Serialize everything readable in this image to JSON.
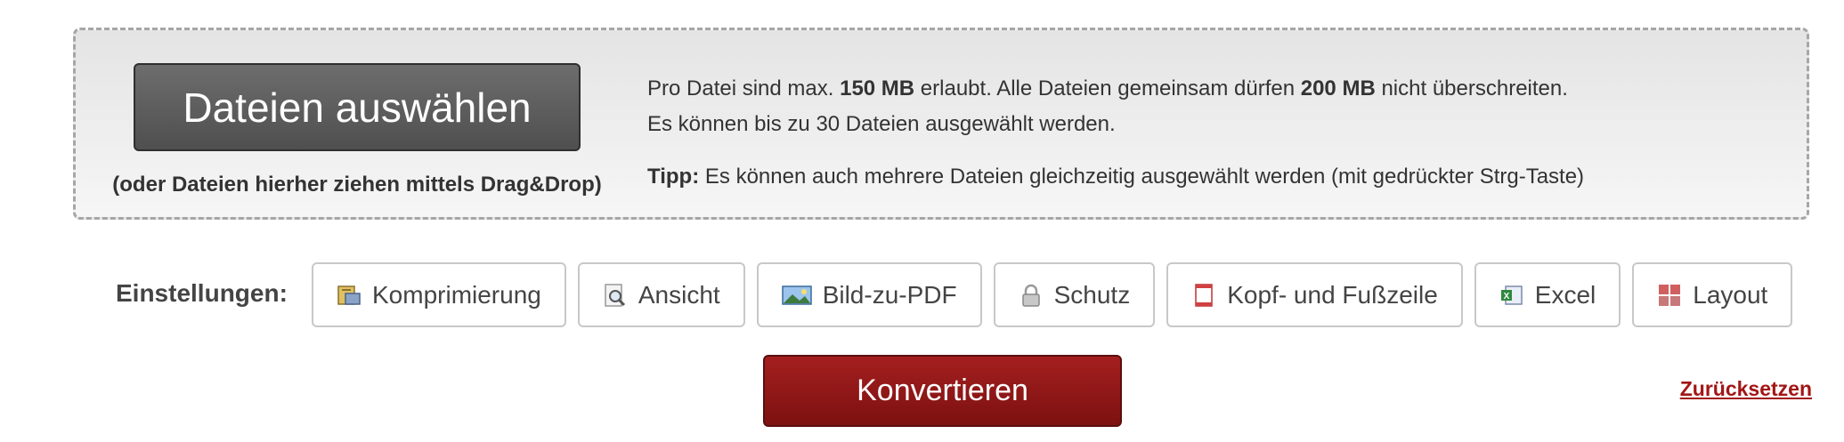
{
  "upload": {
    "choose_label": "Dateien auswählen",
    "drag_hint": "(oder Dateien hierher ziehen mittels Drag&Drop)",
    "info_line1_part1": "Pro Datei sind max. ",
    "info_line1_bold1": "150 MB",
    "info_line1_part2": " erlaubt. Alle Dateien gemeinsam dürfen ",
    "info_line1_bold2": "200 MB",
    "info_line1_part3": " nicht überschreiten.",
    "info_line2": "Es können bis zu 30 Dateien ausgewählt werden.",
    "tip_label": "Tipp:",
    "tip_text": " Es können auch mehrere Dateien gleichzeitig ausgewählt werden (mit gedrückter Strg-Taste)"
  },
  "settings": {
    "label": "Einstellungen:",
    "buttons": [
      {
        "label": "Komprimierung",
        "icon": "compress-icon"
      },
      {
        "label": "Ansicht",
        "icon": "magnifier-icon"
      },
      {
        "label": "Bild-zu-PDF",
        "icon": "image-icon"
      },
      {
        "label": "Schutz",
        "icon": "lock-icon"
      },
      {
        "label": "Kopf- und Fußzeile",
        "icon": "document-icon"
      },
      {
        "label": "Excel",
        "icon": "excel-icon"
      },
      {
        "label": "Layout",
        "icon": "layout-grid-icon"
      }
    ]
  },
  "actions": {
    "convert_label": "Konvertieren",
    "reset_label": "Zurücksetzen"
  },
  "colors": {
    "convert_bg": "#8f1818",
    "reset_link": "#a31515",
    "choose_bg": "#5a5a5a"
  }
}
